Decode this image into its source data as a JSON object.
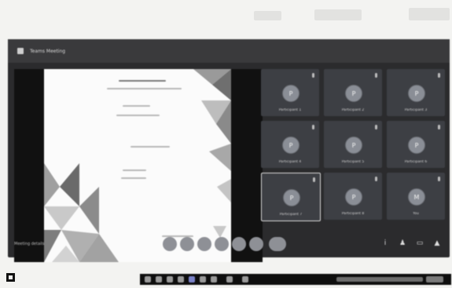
{
  "colors": {
    "window_bg": "#2b2b2d",
    "tile_bg": "#3d3f44",
    "avatar": "#8a8e96",
    "taskbar": "#0e0e0e"
  },
  "window": {
    "title": "Teams Meeting",
    "icon": "app-icon"
  },
  "meeting": {
    "info": "Meeting details"
  },
  "tiles": [
    {
      "name": "Participant 1",
      "initial": "P"
    },
    {
      "name": "Participant 2",
      "initial": "P"
    },
    {
      "name": "Participant 3",
      "initial": "P"
    },
    {
      "name": "Participant 4",
      "initial": "P"
    },
    {
      "name": "Participant 5",
      "initial": "P"
    },
    {
      "name": "Participant 6",
      "initial": "P"
    },
    {
      "name": "Participant 7",
      "initial": "P"
    },
    {
      "name": "Participant 8",
      "initial": "P"
    },
    {
      "name": "You",
      "initial": "M"
    }
  ],
  "controls": [
    "camera-icon",
    "mic-icon",
    "share-icon",
    "raise-hand-icon",
    "more-icon",
    "leave-icon"
  ],
  "taskbar": {
    "items": [
      "search-icon",
      "task-view-icon",
      "explorer-icon",
      "chrome-icon",
      "teams-icon",
      "word-icon"
    ]
  }
}
